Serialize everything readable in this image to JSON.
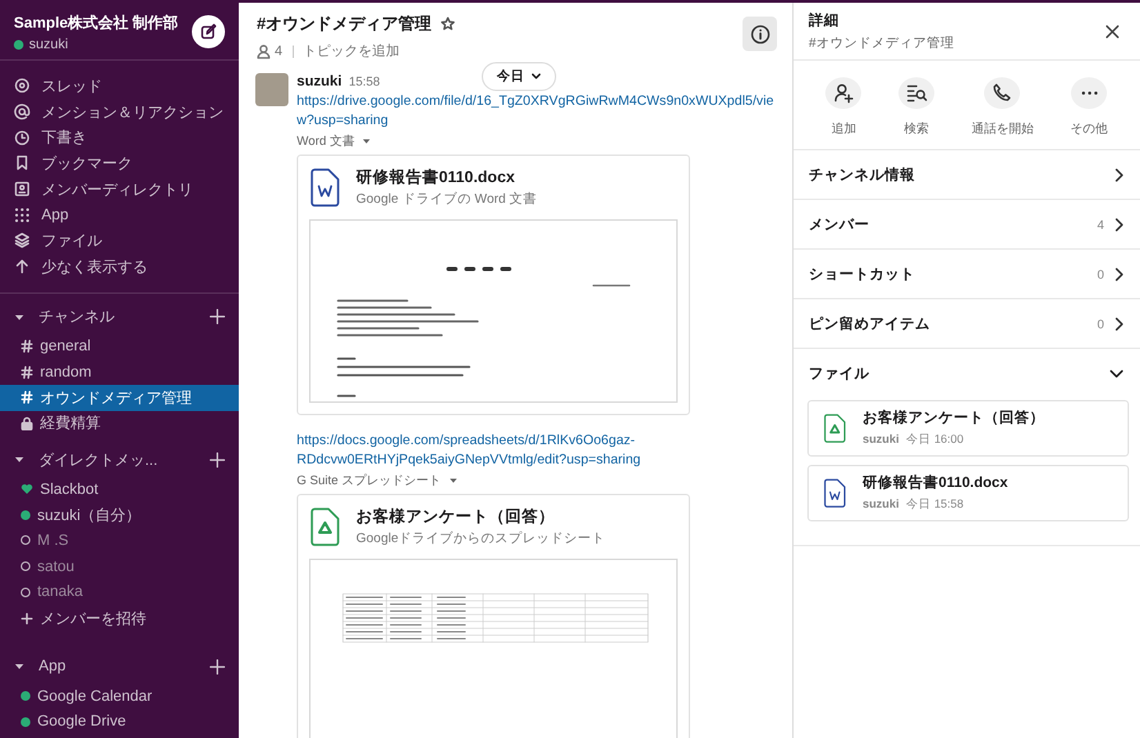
{
  "workspace": {
    "name": "Sample株式会社 制作部",
    "user": "suzuki",
    "online": true
  },
  "nav": [
    {
      "label": "スレッド",
      "kind": "threads"
    },
    {
      "label": "メンション＆リアクション",
      "kind": "mentions"
    },
    {
      "label": "下書き",
      "kind": "drafts"
    },
    {
      "label": "ブックマーク",
      "kind": "bookmarks"
    },
    {
      "label": "メンバーディレクトリ",
      "kind": "directory"
    },
    {
      "label": "App",
      "kind": "apps"
    },
    {
      "label": "ファイル",
      "kind": "files"
    },
    {
      "label": "少なく表示する",
      "kind": "less"
    }
  ],
  "sections": [
    {
      "title": "チャンネル",
      "expanded": true,
      "items": [
        {
          "label": "general",
          "kind": "channel",
          "selected": false
        },
        {
          "label": "random",
          "kind": "channel",
          "selected": false
        },
        {
          "label": "オウンドメディア管理",
          "kind": "channel",
          "selected": true
        },
        {
          "label": "経費精算",
          "kind": "private",
          "selected": false
        }
      ]
    },
    {
      "title": "ダイレクトメッ...",
      "expanded": true,
      "items": [
        {
          "label": "Slackbot",
          "kind": "bot",
          "selected": false,
          "online": true
        },
        {
          "label": "suzuki（自分）",
          "kind": "dm",
          "selected": false,
          "online": true
        },
        {
          "label": "M .S",
          "kind": "dm",
          "selected": false,
          "online": false
        },
        {
          "label": "satou",
          "kind": "dm",
          "selected": false,
          "online": false
        },
        {
          "label": "tanaka",
          "kind": "dm",
          "selected": false,
          "online": false
        },
        {
          "label": "メンバーを招待",
          "kind": "invite",
          "selected": false
        }
      ]
    },
    {
      "title": "App",
      "expanded": true,
      "items": [
        {
          "label": "Google Calendar",
          "kind": "app",
          "selected": false,
          "online": true
        },
        {
          "label": "Google Drive",
          "kind": "app",
          "selected": false,
          "online": true
        }
      ]
    }
  ],
  "channel": {
    "title": "#オウンドメディア管理",
    "members": "4",
    "topic": "トピックを追加"
  },
  "date_pill": "今日",
  "message": {
    "author": "suzuki",
    "time": "15:58",
    "attachments": [
      {
        "link": "https://drive.google.com/file/d/16_TgZ0XRVgRGiwRwM4CWs9n0xWUXpdl5/view?usp=sharing",
        "label": "Word 文書",
        "title": "研修報告書0110.docx",
        "subtitle": "Google ドライブの Word 文書",
        "kind": "doc"
      },
      {
        "link": "https://docs.google.com/spreadsheets/d/1RlKv6Oo6gaz-RDdcvw0ERtHYjPqek5aiyGNepVVtmlg/edit?usp=sharing",
        "label": "G Suite スプレッドシート",
        "title": "お客様アンケート（回答）",
        "subtitle": "Googleドライブからのスプレッドシート",
        "kind": "sheet"
      }
    ]
  },
  "details": {
    "title": "詳細",
    "subtitle": "#オウンドメディア管理",
    "actions": [
      {
        "label": "追加",
        "kind": "add"
      },
      {
        "label": "検索",
        "kind": "search"
      },
      {
        "label": "通話を開始",
        "kind": "call"
      },
      {
        "label": "その他",
        "kind": "more"
      }
    ],
    "rows": [
      {
        "label": "チャンネル情報"
      },
      {
        "label": "メンバー",
        "count": "4"
      },
      {
        "label": "ショートカット",
        "count": "0"
      },
      {
        "label": "ピン留めアイテム",
        "count": "0"
      }
    ],
    "files_title": "ファイル",
    "files_expanded": true,
    "files": [
      {
        "title": "お客様アンケート（回答）",
        "author": "suzuki",
        "time": "今日 16:00",
        "kind": "sheet"
      },
      {
        "title": "研修報告書0110.docx",
        "author": "suzuki",
        "time": "今日 15:58",
        "kind": "doc"
      }
    ]
  }
}
